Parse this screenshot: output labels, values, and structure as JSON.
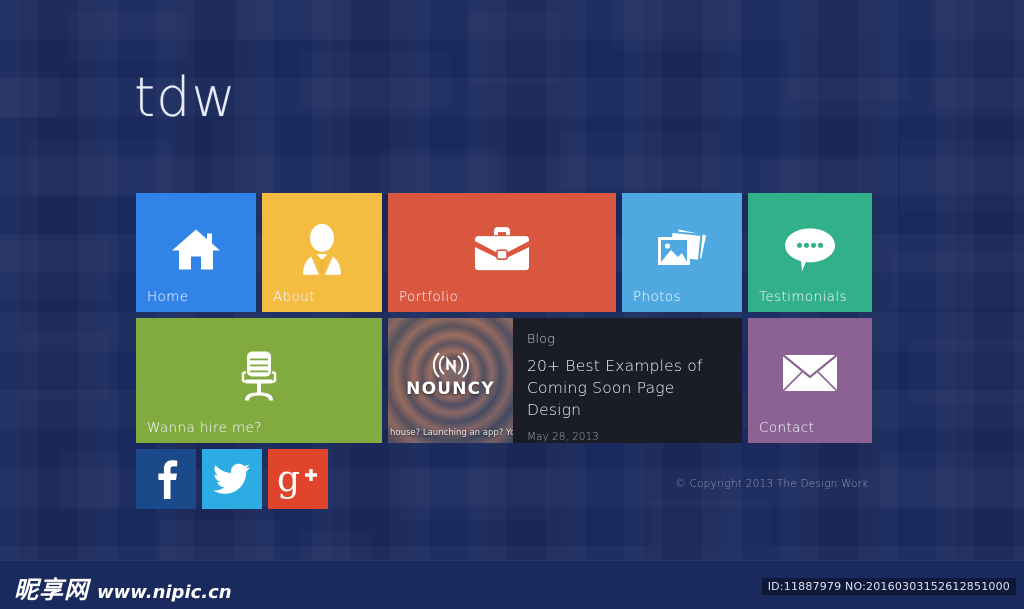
{
  "site": {
    "logo": "tdw",
    "background_color": "#1b2a5e"
  },
  "tiles": [
    {
      "id": "home",
      "label": "Home",
      "icon": "house-icon",
      "color": "#3283e8"
    },
    {
      "id": "about",
      "label": "About",
      "icon": "person-icon",
      "color": "#f5bc42"
    },
    {
      "id": "portfolio",
      "label": "Portfolio",
      "icon": "briefcase-icon",
      "color": "#d9563f"
    },
    {
      "id": "photos",
      "label": "Photos",
      "icon": "photos-icon",
      "color": "#4fa9e0"
    },
    {
      "id": "testimonials",
      "label": "Testimonials",
      "icon": "speech-bubble-icon",
      "color": "#32b08a"
    },
    {
      "id": "hire",
      "label": "Wanna hire me?",
      "icon": "office-chair-icon",
      "color": "#81ab3f"
    },
    {
      "id": "contact",
      "label": "Contact",
      "icon": "envelope-icon",
      "color": "#8b6293"
    }
  ],
  "blog": {
    "kicker": "Blog",
    "title": "20+ Best Examples of Coming Soon Page Design",
    "date": "May 28, 2013",
    "background_color": "#1a1c26",
    "thumbnail": {
      "logo_glyph": "((•))",
      "brand": "NOUNCY",
      "caption": "house? Launching an app? Your dog"
    }
  },
  "social": [
    {
      "id": "facebook",
      "label": "Facebook",
      "glyph": "f",
      "color": "#1a4a8a"
    },
    {
      "id": "twitter",
      "label": "Twitter",
      "glyph": "",
      "color": "#2cace3"
    },
    {
      "id": "googleplus",
      "label": "Google Plus",
      "glyph": "g+",
      "color": "#e0452c"
    }
  ],
  "footer": {
    "copyright": "© Copyright 2013 The Design Work."
  },
  "watermark": {
    "brand_cn": "昵享网",
    "url": "www.nipic.cn",
    "id_text": "ID:11887979 NO:20160303152612851000"
  }
}
